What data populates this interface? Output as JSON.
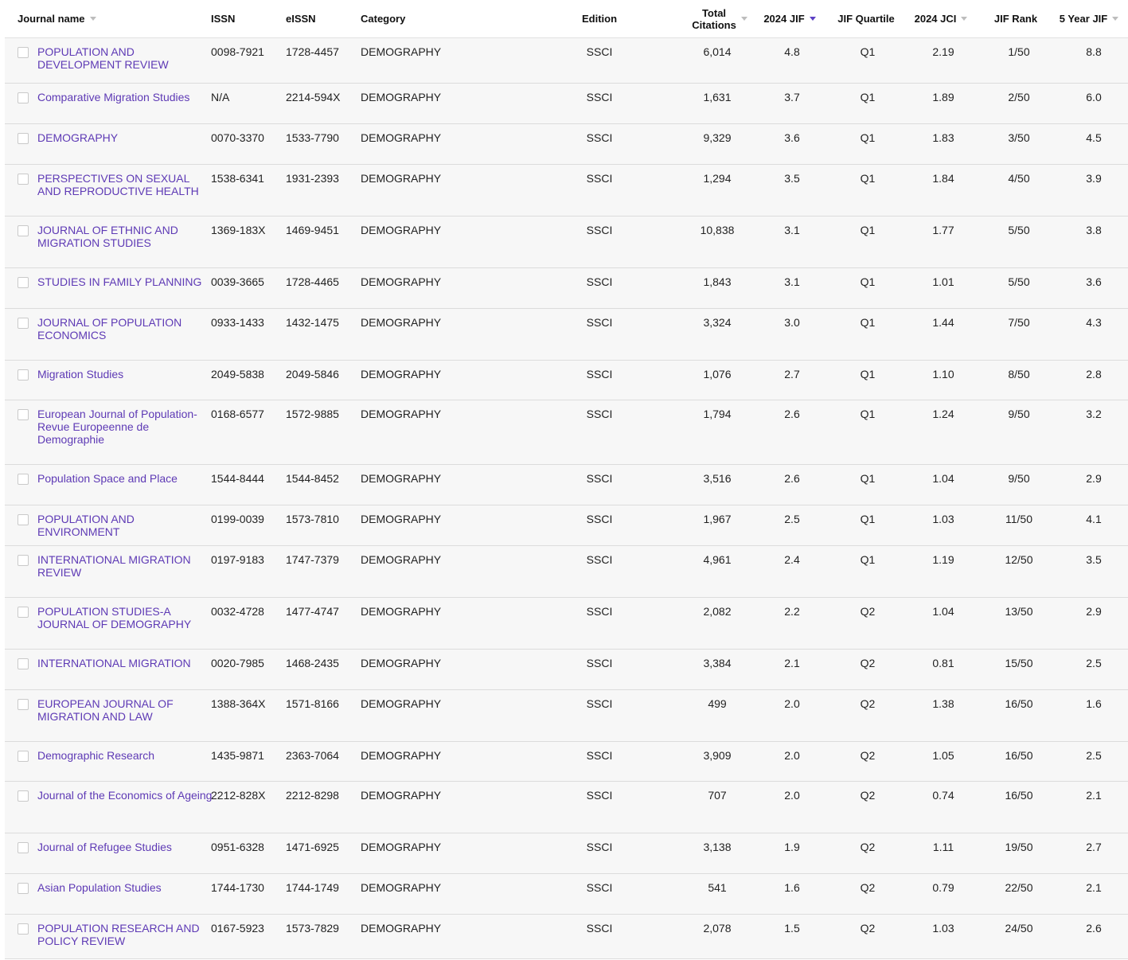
{
  "header": {
    "journal_name": "Journal name",
    "issn": "ISSN",
    "eissn": "eISSN",
    "category": "Category",
    "edition": "Edition",
    "total_citations": "Total\nCitations",
    "jif": "2024 JIF",
    "jif_quartile": "JIF Quartile",
    "jci": "2024 JCI",
    "jif_rank": "JIF Rank",
    "five_year_jif": "5 Year JIF"
  },
  "colors": {
    "link": "#5e3ab5",
    "sort_active": "#5c3fc4",
    "row_bg": "#f7f7f7"
  },
  "rows": [
    {
      "name": "POPULATION AND DEVELOPMENT REVIEW",
      "issn": "0098-7921",
      "eissn": "1728-4457",
      "category": "DEMOGRAPHY",
      "edition": "SSCI",
      "citations": "6,014",
      "jif": "4.8",
      "quartile": "Q1",
      "jci": "2.19",
      "rank": "1/50",
      "jif5": "8.8"
    },
    {
      "name": "Comparative Migration Studies",
      "issn": "N/A",
      "eissn": "2214-594X",
      "category": "DEMOGRAPHY",
      "edition": "SSCI",
      "citations": "1,631",
      "jif": "3.7",
      "quartile": "Q1",
      "jci": "1.89",
      "rank": "2/50",
      "jif5": "6.0"
    },
    {
      "name": "DEMOGRAPHY",
      "issn": "0070-3370",
      "eissn": "1533-7790",
      "category": "DEMOGRAPHY",
      "edition": "SSCI",
      "citations": "9,329",
      "jif": "3.6",
      "quartile": "Q1",
      "jci": "1.83",
      "rank": "3/50",
      "jif5": "4.5"
    },
    {
      "name": "PERSPECTIVES ON SEXUAL AND REPRODUCTIVE HEALTH",
      "issn": "1538-6341",
      "eissn": "1931-2393",
      "category": "DEMOGRAPHY",
      "edition": "SSCI",
      "citations": "1,294",
      "jif": "3.5",
      "quartile": "Q1",
      "jci": "1.84",
      "rank": "4/50",
      "jif5": "3.9"
    },
    {
      "name": "JOURNAL OF ETHNIC AND MIGRATION STUDIES",
      "issn": "1369-183X",
      "eissn": "1469-9451",
      "category": "DEMOGRAPHY",
      "edition": "SSCI",
      "citations": "10,838",
      "jif": "3.1",
      "quartile": "Q1",
      "jci": "1.77",
      "rank": "5/50",
      "jif5": "3.8"
    },
    {
      "name": "STUDIES IN FAMILY PLANNING",
      "issn": "0039-3665",
      "eissn": "1728-4465",
      "category": "DEMOGRAPHY",
      "edition": "SSCI",
      "citations": "1,843",
      "jif": "3.1",
      "quartile": "Q1",
      "jci": "1.01",
      "rank": "5/50",
      "jif5": "3.6"
    },
    {
      "name": "JOURNAL OF POPULATION ECONOMICS",
      "issn": "0933-1433",
      "eissn": "1432-1475",
      "category": "DEMOGRAPHY",
      "edition": "SSCI",
      "citations": "3,324",
      "jif": "3.0",
      "quartile": "Q1",
      "jci": "1.44",
      "rank": "7/50",
      "jif5": "4.3"
    },
    {
      "name": "Migration Studies",
      "issn": "2049-5838",
      "eissn": "2049-5846",
      "category": "DEMOGRAPHY",
      "edition": "SSCI",
      "citations": "1,076",
      "jif": "2.7",
      "quartile": "Q1",
      "jci": "1.10",
      "rank": "8/50",
      "jif5": "2.8"
    },
    {
      "name": "European Journal of Population-Revue Europeenne de Demographie",
      "issn": "0168-6577",
      "eissn": "1572-9885",
      "category": "DEMOGRAPHY",
      "edition": "SSCI",
      "citations": "1,794",
      "jif": "2.6",
      "quartile": "Q1",
      "jci": "1.24",
      "rank": "9/50",
      "jif5": "3.2"
    },
    {
      "name": "Population Space and Place",
      "issn": "1544-8444",
      "eissn": "1544-8452",
      "category": "DEMOGRAPHY",
      "edition": "SSCI",
      "citations": "3,516",
      "jif": "2.6",
      "quartile": "Q1",
      "jci": "1.04",
      "rank": "9/50",
      "jif5": "2.9"
    },
    {
      "name": "POPULATION AND ENVIRONMENT",
      "issn": "0199-0039",
      "eissn": "1573-7810",
      "category": "DEMOGRAPHY",
      "edition": "SSCI",
      "citations": "1,967",
      "jif": "2.5",
      "quartile": "Q1",
      "jci": "1.03",
      "rank": "11/50",
      "jif5": "4.1"
    },
    {
      "name": "INTERNATIONAL MIGRATION REVIEW",
      "issn": "0197-9183",
      "eissn": "1747-7379",
      "category": "DEMOGRAPHY",
      "edition": "SSCI",
      "citations": "4,961",
      "jif": "2.4",
      "quartile": "Q1",
      "jci": "1.19",
      "rank": "12/50",
      "jif5": "3.5"
    },
    {
      "name": "POPULATION STUDIES-A JOURNAL OF DEMOGRAPHY",
      "issn": "0032-4728",
      "eissn": "1477-4747",
      "category": "DEMOGRAPHY",
      "edition": "SSCI",
      "citations": "2,082",
      "jif": "2.2",
      "quartile": "Q2",
      "jci": "1.04",
      "rank": "13/50",
      "jif5": "2.9"
    },
    {
      "name": "INTERNATIONAL MIGRATION",
      "issn": "0020-7985",
      "eissn": "1468-2435",
      "category": "DEMOGRAPHY",
      "edition": "SSCI",
      "citations": "3,384",
      "jif": "2.1",
      "quartile": "Q2",
      "jci": "0.81",
      "rank": "15/50",
      "jif5": "2.5"
    },
    {
      "name": "EUROPEAN JOURNAL OF MIGRATION AND LAW",
      "issn": "1388-364X",
      "eissn": "1571-8166",
      "category": "DEMOGRAPHY",
      "edition": "SSCI",
      "citations": "499",
      "jif": "2.0",
      "quartile": "Q2",
      "jci": "1.38",
      "rank": "16/50",
      "jif5": "1.6"
    },
    {
      "name": "Demographic Research",
      "issn": "1435-9871",
      "eissn": "2363-7064",
      "category": "DEMOGRAPHY",
      "edition": "SSCI",
      "citations": "3,909",
      "jif": "2.0",
      "quartile": "Q2",
      "jci": "1.05",
      "rank": "16/50",
      "jif5": "2.5"
    },
    {
      "name": "Journal of the Economics of Ageing",
      "issn": "2212-828X",
      "eissn": "2212-8298",
      "category": "DEMOGRAPHY",
      "edition": "SSCI",
      "citations": "707",
      "jif": "2.0",
      "quartile": "Q2",
      "jci": "0.74",
      "rank": "16/50",
      "jif5": "2.1"
    },
    {
      "name": "Journal of Refugee Studies",
      "issn": "0951-6328",
      "eissn": "1471-6925",
      "category": "DEMOGRAPHY",
      "edition": "SSCI",
      "citations": "3,138",
      "jif": "1.9",
      "quartile": "Q2",
      "jci": "1.11",
      "rank": "19/50",
      "jif5": "2.7"
    },
    {
      "name": "Asian Population Studies",
      "issn": "1744-1730",
      "eissn": "1744-1749",
      "category": "DEMOGRAPHY",
      "edition": "SSCI",
      "citations": "541",
      "jif": "1.6",
      "quartile": "Q2",
      "jci": "0.79",
      "rank": "22/50",
      "jif5": "2.1"
    },
    {
      "name": "POPULATION RESEARCH AND POLICY REVIEW",
      "issn": "0167-5923",
      "eissn": "1573-7829",
      "category": "DEMOGRAPHY",
      "edition": "SSCI",
      "citations": "2,078",
      "jif": "1.5",
      "quartile": "Q2",
      "jci": "1.03",
      "rank": "24/50",
      "jif5": "2.6"
    }
  ]
}
